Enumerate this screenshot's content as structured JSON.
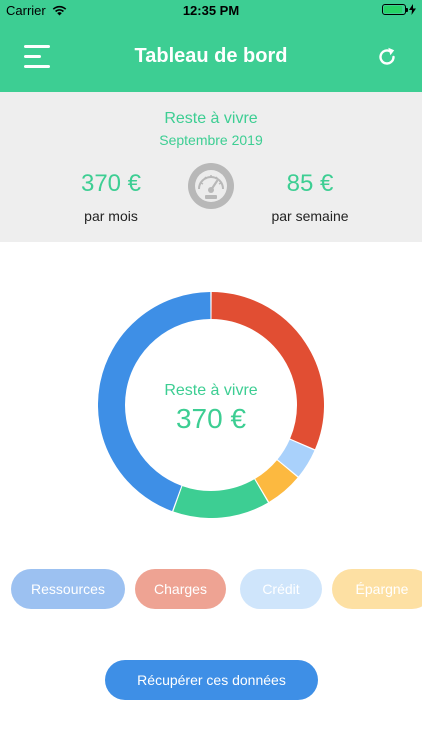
{
  "status_bar": {
    "carrier": "Carrier",
    "time": "12:35 PM",
    "battery_level": 0.9
  },
  "header": {
    "title": "Tableau de bord",
    "menu_icon": "hamburger-menu-icon",
    "refresh_icon": "refresh-icon",
    "background_color": "#3dce93"
  },
  "summary": {
    "title": "Reste à vivre",
    "month": "Septembre 2019",
    "monthly_amount": "370 €",
    "monthly_label": "par mois",
    "weekly_amount": "85 €",
    "weekly_label": "par semaine",
    "gauge_icon": "speedometer-icon"
  },
  "donut": {
    "center_label": "Reste à vivre",
    "center_amount": "370 €"
  },
  "chart_data": {
    "type": "pie",
    "title": "",
    "center_label": "Reste à vivre",
    "center_value": "370 €",
    "slices": [
      {
        "color": "#e14e33",
        "fraction": 0.315
      },
      {
        "color": "#a9d1fb",
        "fraction": 0.045
      },
      {
        "color": "#fcb940",
        "fraction": 0.055
      },
      {
        "color": "#3dce93",
        "fraction": 0.14
      },
      {
        "color": "#3e8fe6",
        "fraction": 0.445
      }
    ]
  },
  "categories": [
    {
      "label": "Ressources",
      "color": "#9cc1f1"
    },
    {
      "label": "Charges",
      "color": "#eea393"
    },
    {
      "label": "Crédit",
      "color": "#cfe5fb"
    },
    {
      "label": "Épargne",
      "color": "#fde0a3"
    }
  ],
  "actions": {
    "fetch_label": "Récupérer ces données"
  }
}
